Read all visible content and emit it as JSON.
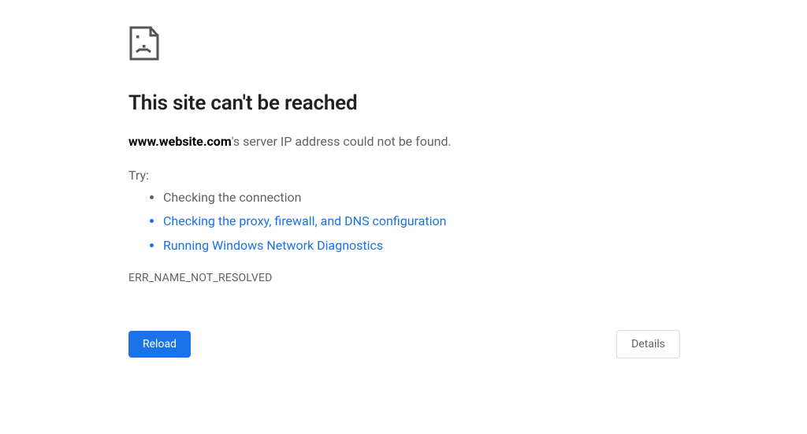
{
  "page": {
    "heading": "This site can't be reached",
    "host": "www.website.com",
    "message_suffix": "'s server IP address could not be found.",
    "try_label": "Try:",
    "suggestions": [
      {
        "text": "Checking the connection",
        "link": false
      },
      {
        "text": "Checking the proxy, firewall, and DNS configuration",
        "link": true
      },
      {
        "text": "Running Windows Network Diagnostics",
        "link": true
      }
    ],
    "error_code": "ERR_NAME_NOT_RESOLVED",
    "reload_label": "Reload",
    "details_label": "Details"
  }
}
